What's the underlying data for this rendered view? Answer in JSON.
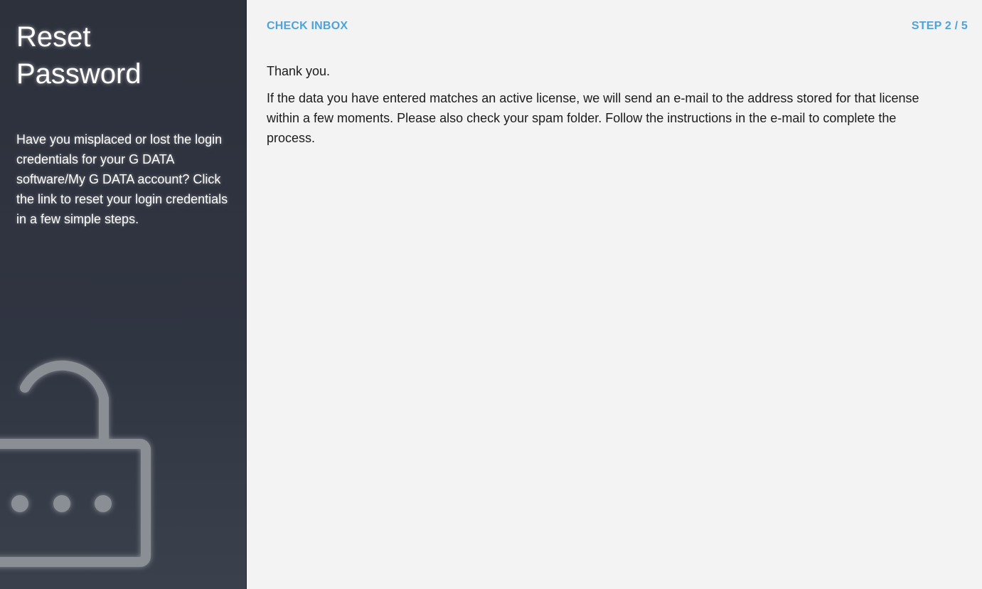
{
  "sidebar": {
    "title": "Reset\nPassword",
    "description": "Have you misplaced or lost the login credentials for your G DATA software/My G DATA account? Click the link to reset your login credentials in a few simple steps.",
    "illustration_icon": "padlock-open-icon"
  },
  "header": {
    "step_name": "CHECK INBOX",
    "step_counter": "STEP 2 / 5"
  },
  "content": {
    "greeting": "Thank you.",
    "body": "If the data you have entered matches an active license, we will send an e-mail to the address stored for that license within a few moments. Please also check your spam folder. Follow the instructions in the e-mail to complete the process."
  },
  "colors": {
    "sidebar_bg": "#2d313c",
    "main_bg": "#f3f3f3",
    "accent": "#4fa3d8",
    "text": "#1b1b1b"
  }
}
